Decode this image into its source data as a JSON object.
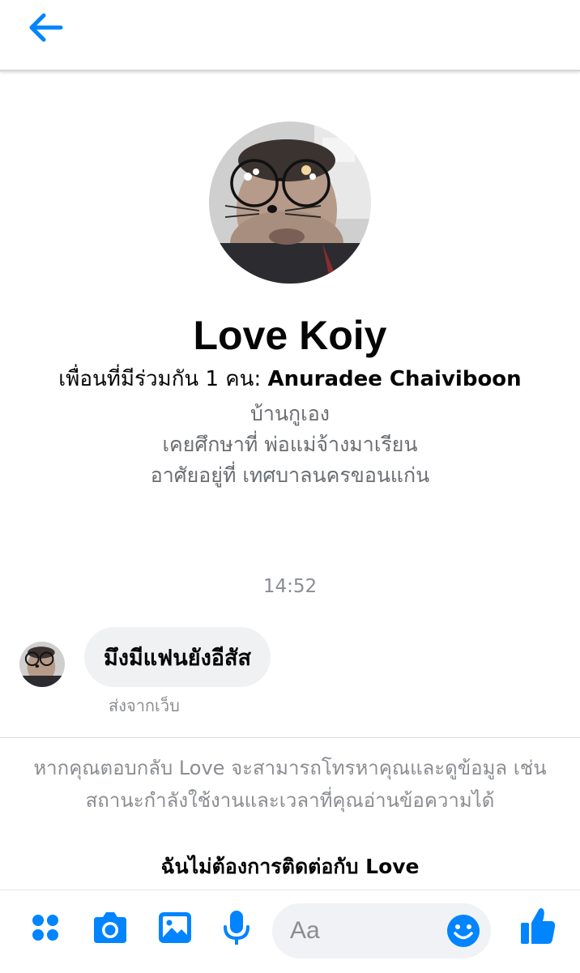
{
  "colors": {
    "accent": "#0084ff",
    "text_primary": "#050505",
    "text_secondary": "#6b6e72",
    "text_muted": "#8a8d91",
    "bubble_bg": "#f0f1f3"
  },
  "header": {
    "back_icon": "arrow-left-icon"
  },
  "profile": {
    "name": "Love Koiy",
    "mutual_label": "เพื่อนที่มีร่วมกัน 1 คน:",
    "mutual_friend": "Anuradee Chaiviboon",
    "info": [
      "บ้านกูเอง",
      "เคยศึกษาที่ พ่อแม่จ้างมาเรียน",
      "อาศัยอยู่ที่ เทศบาลนครขอนแก่น"
    ]
  },
  "conversation": {
    "timestamp": "14:52",
    "messages": [
      {
        "text": "มึงมีแฟนยังอีสัส",
        "sent_from": "ส่งจากเว็บ"
      }
    ]
  },
  "request": {
    "notice": "หากคุณตอบกลับ Love จะสามารถโทรหาคุณและดูข้อมูล เช่น สถานะกำลังใช้งานและเวลาที่คุณอ่านข้อความได้",
    "block_label": "ฉันไม่ต้องการติดต่อกับ Love"
  },
  "composer": {
    "placeholder": "Aa",
    "tools": [
      "apps-icon",
      "camera-icon",
      "gallery-icon",
      "microphone-icon"
    ],
    "emoji_icon": "emoji-icon",
    "like_icon": "thumbs-up-icon"
  }
}
